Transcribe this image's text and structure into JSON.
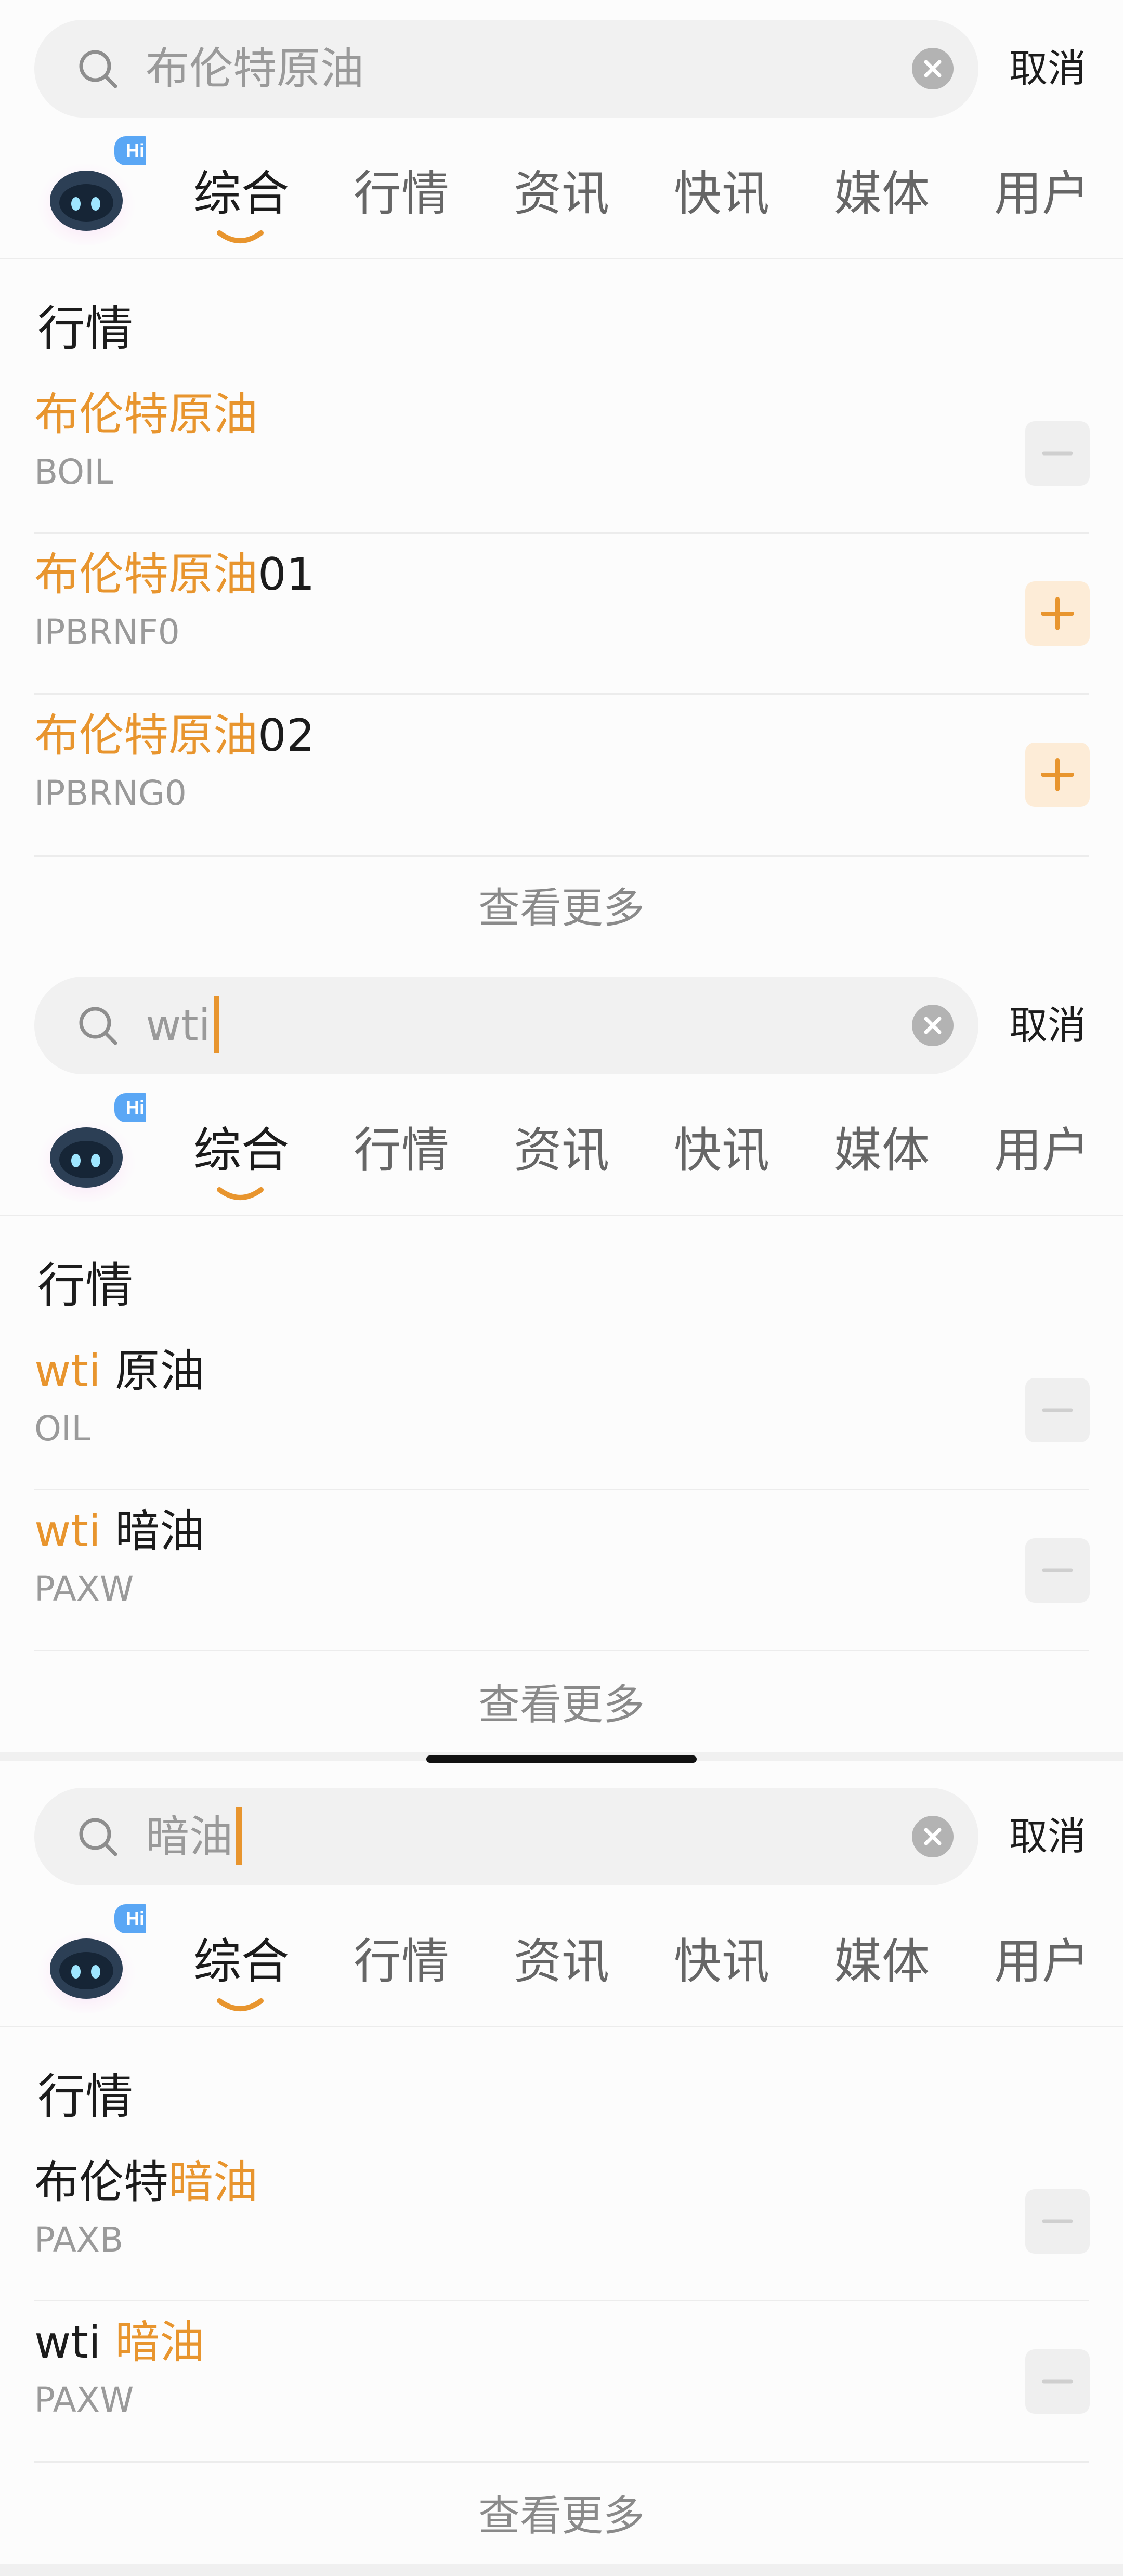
{
  "colors": {
    "accent": "#e8952e",
    "text": "#1c1c1c",
    "muted": "#9a9a9a",
    "tab_inactive": "#666666"
  },
  "panels": [
    {
      "search": {
        "value": "布伦特原油",
        "has_caret": false,
        "cancel_label": "取消"
      },
      "assistant_badge": "Hi",
      "tabs": [
        "综合",
        "行情",
        "资讯",
        "快讯",
        "媒体",
        "用户"
      ],
      "active_tab": "综合",
      "section_title": "行情",
      "results": [
        {
          "name_highlight": "布伦特原油",
          "name_rest": "",
          "code": "BOIL",
          "action": "minus-icon"
        },
        {
          "name_highlight": "布伦特原油",
          "name_rest": "01",
          "code": "IPBRNF0",
          "action": "plus-icon"
        },
        {
          "name_highlight": "布伦特原油",
          "name_rest": "02",
          "code": "IPBRNG0",
          "action": "plus-icon"
        }
      ],
      "see_more": "查看更多"
    },
    {
      "search": {
        "value": "wti",
        "has_caret": true,
        "cancel_label": "取消"
      },
      "assistant_badge": "Hi",
      "tabs": [
        "综合",
        "行情",
        "资讯",
        "快讯",
        "媒体",
        "用户"
      ],
      "active_tab": "综合",
      "section_title": "行情",
      "results": [
        {
          "name_highlight": "wti",
          "name_rest": "原油",
          "code": "OIL",
          "action": "minus-icon"
        },
        {
          "name_highlight": "wti",
          "name_rest": "暗油",
          "code": "PAXW",
          "action": "minus-icon"
        }
      ],
      "see_more": "查看更多"
    },
    {
      "search": {
        "value": "暗油",
        "has_caret": true,
        "cancel_label": "取消"
      },
      "assistant_badge": "Hi",
      "tabs": [
        "综合",
        "行情",
        "资讯",
        "快讯",
        "媒体",
        "用户"
      ],
      "active_tab": "综合",
      "section_title": "行情",
      "results": [
        {
          "name_prefix": "布伦特",
          "name_highlight": "暗油",
          "code": "PAXB",
          "action": "minus-icon"
        },
        {
          "name_prefix": "wti",
          "name_highlight": "暗油",
          "code": "PAXW",
          "action": "minus-icon"
        }
      ],
      "see_more": "查看更多"
    }
  ]
}
